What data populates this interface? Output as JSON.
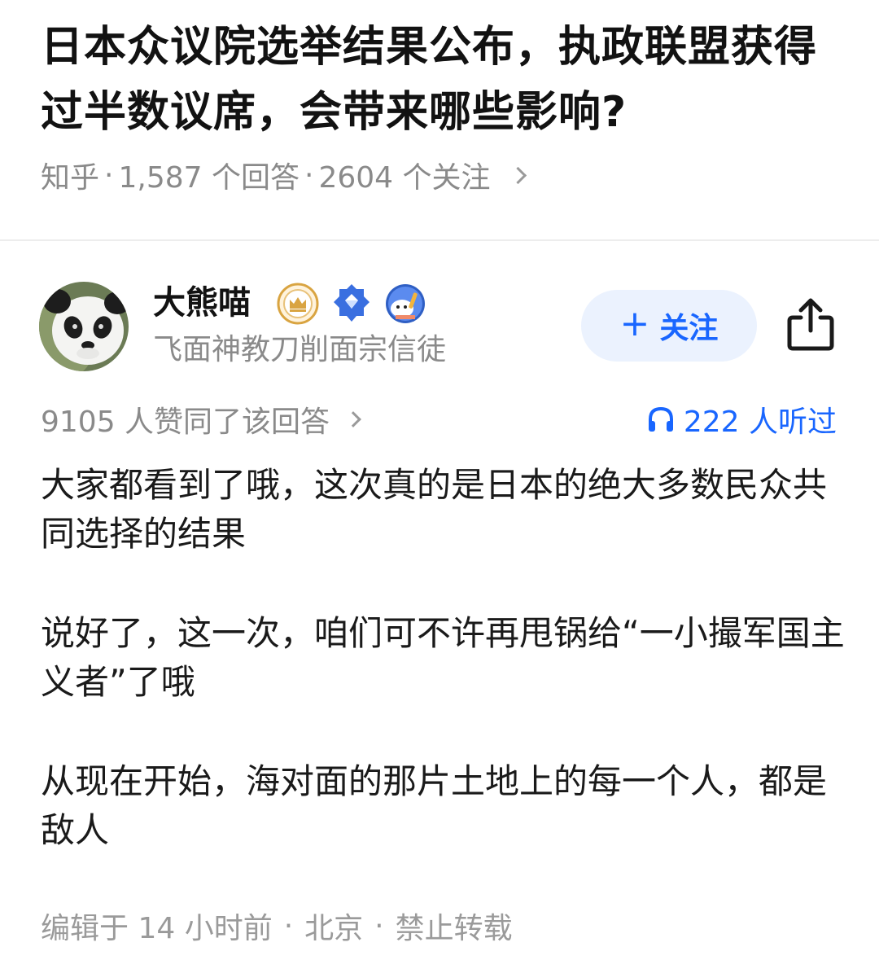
{
  "question": {
    "title": "日本众议院选举结果公布，执政联盟获得过半数议席，会带来哪些影响?",
    "source": "知乎",
    "answer_count": "1,587 个回答",
    "follower_count": "2604 个关注"
  },
  "author": {
    "name": "大熊喵",
    "bio": "飞面神教刀削面宗信徒",
    "badges": [
      "crown-badge",
      "diamond-badge",
      "creator-badge"
    ],
    "follow_label": "关注"
  },
  "stats": {
    "votes": "9105 人赞同了该回答",
    "listened": "222 人听过"
  },
  "content": {
    "paragraphs": [
      "大家都看到了哦，这次真的是日本的绝大多数民众共同选择的结果",
      "说好了，这一次，咱们可不许再甩锅给“一小撮军国主义者”了哦",
      "从现在开始，海对面的那片土地上的每一个人，都是敌人"
    ]
  },
  "footer": {
    "edited": "编辑于 14 小时前",
    "location": "北京",
    "copyright": "禁止转载"
  },
  "colors": {
    "accent": "#1966ff",
    "follow_bg": "#ebf2fe",
    "muted_text": "#8a8a8a",
    "badge_gold": "#d9a441",
    "badge_blue": "#3a6fe0"
  }
}
